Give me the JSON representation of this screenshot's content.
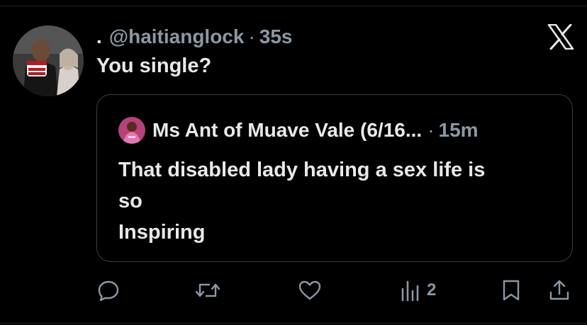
{
  "post": {
    "display_name": ".",
    "handle": "@haitianglock",
    "separator": "·",
    "time": "35s",
    "text": "You single?"
  },
  "quote": {
    "author_name": "Ms Ant of Muave Vale (6/16...",
    "separator": "·",
    "time": "15m",
    "lines": [
      "That disabled lady having a sex life is",
      "so",
      "Inspiring"
    ]
  },
  "actions": {
    "views_count": "2"
  },
  "icons": {
    "brand": "x-logo-icon",
    "reply": "reply-icon",
    "repost": "repost-icon",
    "like": "heart-icon",
    "views": "views-icon",
    "bookmark": "bookmark-icon",
    "share": "share-icon"
  },
  "colors": {
    "background": "#000000",
    "text_primary": "#e7e9ea",
    "text_secondary": "#8b98a5",
    "border": "#3a3f44"
  }
}
